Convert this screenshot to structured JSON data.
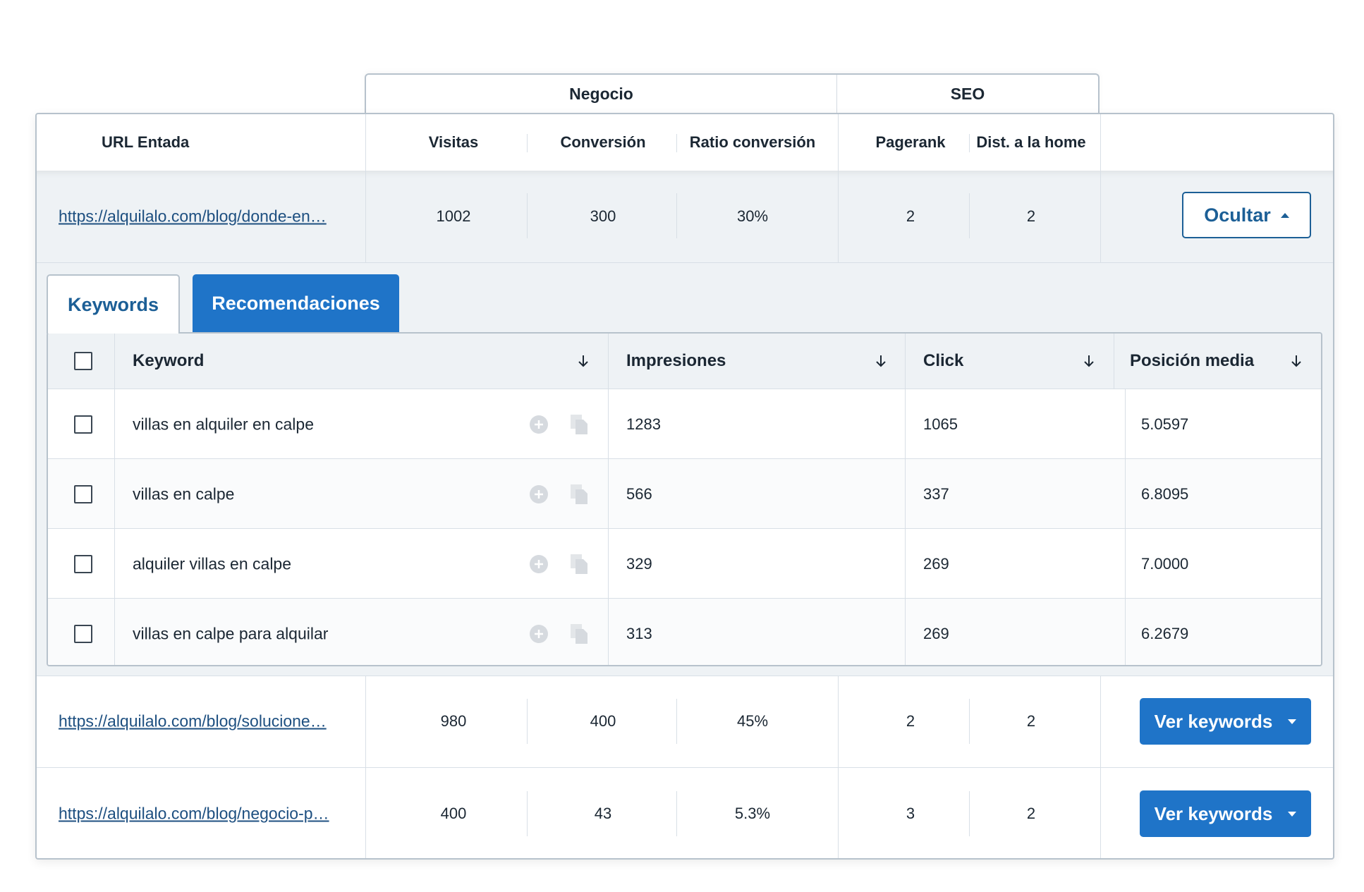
{
  "groups": {
    "negocio": "Negocio",
    "seo": "SEO"
  },
  "columns": {
    "url": "URL Entada",
    "visitas": "Visitas",
    "conversion": "Conversión",
    "ratio": "Ratio conversión",
    "pagerank": "Pagerank",
    "dist": "Dist. a la home"
  },
  "rows": [
    {
      "url": "https://alquilalo.com/blog/donde-en…",
      "visitas": "1002",
      "conversion": "300",
      "ratio": "30%",
      "pagerank": "2",
      "dist": "2",
      "action": "Ocultar"
    },
    {
      "url": "https://alquilalo.com/blog/solucione…",
      "visitas": "980",
      "conversion": "400",
      "ratio": "45%",
      "pagerank": "2",
      "dist": "2",
      "action": "Ver keywords"
    },
    {
      "url": "https://alquilalo.com/blog/negocio-p…",
      "visitas": "400",
      "conversion": "43",
      "ratio": "5.3%",
      "pagerank": "3",
      "dist": "2",
      "action": "Ver keywords"
    }
  ],
  "tabs": {
    "keywords": "Keywords",
    "recomendaciones": "Recomendaciones"
  },
  "keyword_table": {
    "headers": {
      "keyword": "Keyword",
      "impresiones": "Impresiones",
      "click": "Click",
      "posicion": "Posición media"
    },
    "rows": [
      {
        "keyword": "villas en alquiler en calpe",
        "impresiones": "1283",
        "click": "1065",
        "posicion": "5.0597"
      },
      {
        "keyword": "villas en calpe",
        "impresiones": "566",
        "click": "337",
        "posicion": "6.8095"
      },
      {
        "keyword": "alquiler villas en calpe",
        "impresiones": "329",
        "click": "269",
        "posicion": "7.0000"
      },
      {
        "keyword": "villas en calpe para alquilar",
        "impresiones": "313",
        "click": "269",
        "posicion": "6.2679"
      }
    ]
  },
  "icons": {
    "add": "plus-circle-icon",
    "copy": "copy-icon",
    "sort": "arrow-down-icon"
  },
  "colors": {
    "primary": "#1f74c8",
    "primary_dark": "#1c5f96",
    "link": "#1d4f80",
    "row_bg": "#eef2f5"
  }
}
